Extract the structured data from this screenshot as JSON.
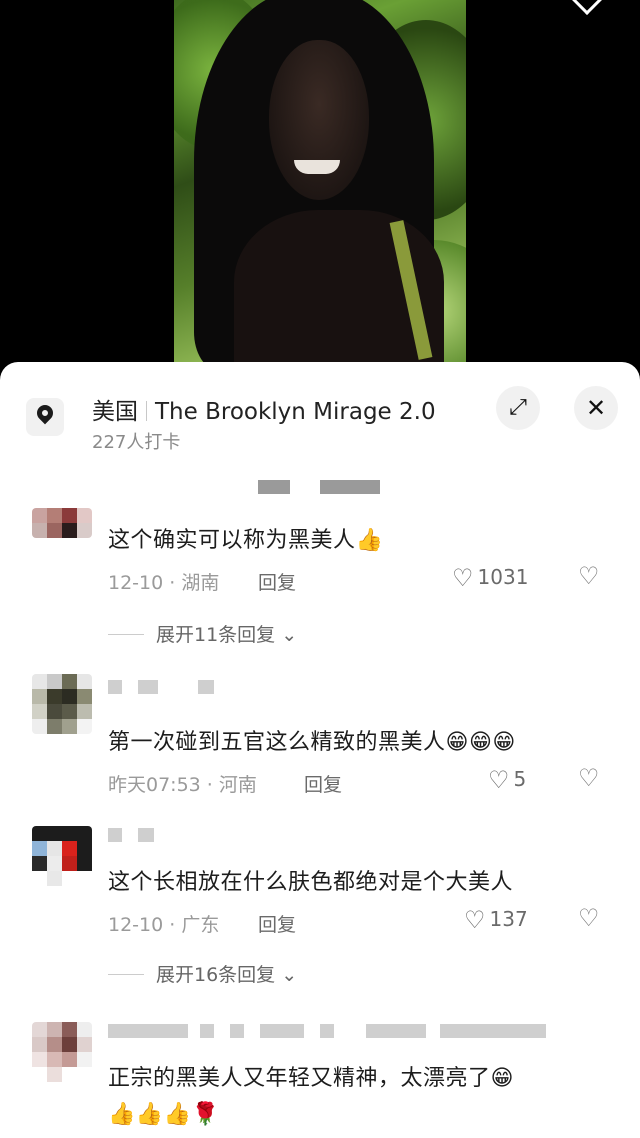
{
  "location": {
    "country": "美国",
    "venue": "The Brooklyn Mirage 2.0",
    "checkins": "227人打卡",
    "icons": {
      "pin": "location-pin-icon",
      "expand": "expand-icon",
      "close": "close-icon"
    },
    "close_symbol": "✕",
    "expand_symbol": "⤢"
  },
  "comments": [
    {
      "text": "这个确实可以称为黑美人",
      "emoji": "👍",
      "date": "12-10",
      "region": "湖南",
      "reply_label": "回复",
      "likes": "1031",
      "expand_replies": "展开11条回复"
    },
    {
      "text": "第一次碰到五官这么精致的黑美人",
      "emoji": "😁😁😁",
      "date": "昨天07:53",
      "region": "河南",
      "reply_label": "回复",
      "likes": "5"
    },
    {
      "text": "这个长相放在什么肤色都绝对是个大美人",
      "emoji": "",
      "date": "12-10",
      "region": "广东",
      "reply_label": "回复",
      "likes": "137",
      "expand_replies": "展开16条回复"
    },
    {
      "text": "正宗的黑美人又年轻又精神，太漂亮了",
      "emoji": "😁",
      "line2": "👍👍👍🌹"
    }
  ],
  "ui": {
    "chevron": "⌄",
    "heart": "♡",
    "dislike": "♡",
    "dot": " · "
  }
}
